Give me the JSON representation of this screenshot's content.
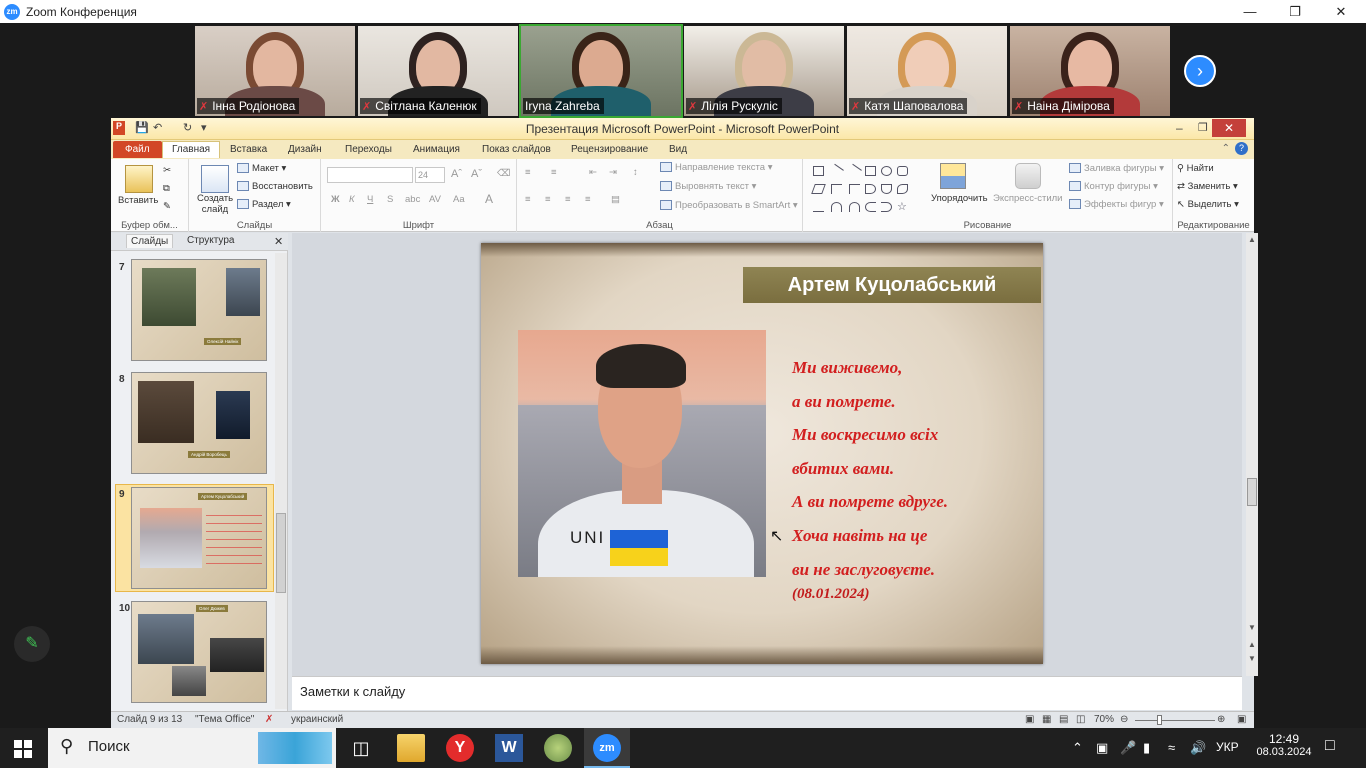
{
  "zoom": {
    "logo": "zm",
    "title": "Zoom Конференция",
    "participants": [
      {
        "name": "Інна Родіонова",
        "muted": true
      },
      {
        "name": "Світлана Каленюк",
        "muted": true
      },
      {
        "name": "Iryna Zahreba",
        "muted": false
      },
      {
        "name": "Лілія Рускуліс",
        "muted": true
      },
      {
        "name": "Катя Шаповалова",
        "muted": true
      },
      {
        "name": "Наіна Дімірова",
        "muted": true
      }
    ]
  },
  "ppt": {
    "title": "Презентация Microsoft PowerPoint  -  Microsoft PowerPoint",
    "tabs": [
      "Файл",
      "Главная",
      "Вставка",
      "Дизайн",
      "Переходы",
      "Анимация",
      "Показ слайдов",
      "Рецензирование",
      "Вид"
    ],
    "ribbon": {
      "paste": "Вставить",
      "clipboard_group": "Буфер обм...",
      "create_slide": "Создать слайд",
      "layout": "Макет",
      "reset": "Восстановить",
      "section": "Раздел",
      "slides_group": "Слайды",
      "font_size": "24",
      "font_group": "Шрифт",
      "text_direction": "Направление текста",
      "align_text": "Выровнять текст",
      "smartart": "Преобразовать в SmartArt",
      "paragraph_group": "Абзац",
      "arrange": "Упорядочить",
      "quick_styles": "Экспресс-стили",
      "drawing_group": "Рисование",
      "shape_fill": "Заливка фигуры",
      "shape_outline": "Контур фигуры",
      "shape_effects": "Эффекты фигур",
      "find": "Найти",
      "replace": "Заменить",
      "select": "Выделить",
      "editing_group": "Редактирование"
    },
    "pane": {
      "tab_slides": "Слайды",
      "tab_outline": "Структура",
      "thumbnails": [
        {
          "num": "7",
          "label": "Олексій Найнік"
        },
        {
          "num": "8",
          "label": "Андрій Воробець"
        },
        {
          "num": "9",
          "label": "Артем Куцолабський"
        },
        {
          "num": "10",
          "label": "Олег Дюжев"
        }
      ]
    },
    "slide": {
      "title": "Артем Куцолабський",
      "shirt_text": "UNI",
      "poem": [
        "Ми виживемо,",
        "а ви помрете.",
        "Ми воскресимо всіх",
        "вбитих вами.",
        "А ви помрете вдруге.",
        "Хоча навіть на це",
        "ви не заслуговуєте."
      ],
      "date": "(08.01.2024)"
    },
    "notes_placeholder": "Заметки к слайду",
    "status": {
      "slide_of": "Слайд 9 из 13",
      "theme": "\"Тема Office\"",
      "language": "украинский",
      "zoom": "70%"
    }
  },
  "taskbar": {
    "search": "Поиск",
    "lang": "УКР",
    "time": "12:49",
    "date": "08.03.2024"
  }
}
